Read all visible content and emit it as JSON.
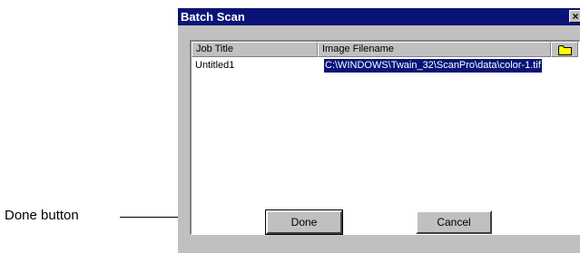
{
  "callout": {
    "label": "Done button"
  },
  "dialog": {
    "title": "Batch Scan",
    "close_glyph": "×",
    "list": {
      "columns": [
        "Job Title",
        "Image Filename"
      ],
      "folder_icon": "folder-icon",
      "rows": [
        {
          "job_title": "Untitled1",
          "image_filename": "C:\\WINDOWS\\Twain_32\\ScanPro\\data\\color-1.tif"
        }
      ]
    },
    "buttons": {
      "done": "Done",
      "cancel": "Cancel"
    }
  },
  "colors": {
    "titlebar": "#0a1477",
    "selection": "#0a1477",
    "face": "#c0c0c0"
  }
}
